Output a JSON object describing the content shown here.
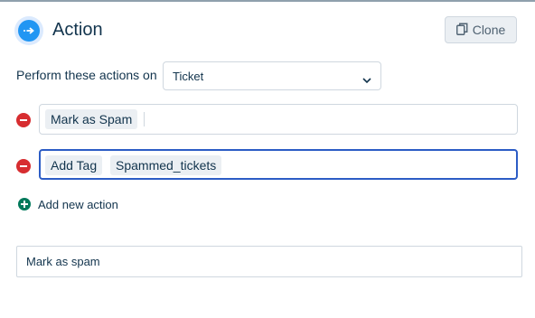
{
  "header": {
    "title": "Action",
    "icon": "arrow-right-circle-icon",
    "clone_label": "Clone",
    "accent": "#2196f3"
  },
  "perform": {
    "label": "Perform these actions on",
    "selected": "Ticket"
  },
  "actions": [
    {
      "chips": [
        "Mark as Spam"
      ]
    },
    {
      "chips": [
        "Add Tag",
        "Spammed_tickets"
      ]
    }
  ],
  "add_action_label": "Add new action",
  "name_field": {
    "value": "Mark as spam"
  },
  "colors": {
    "remove": "#d72d30",
    "add": "#00795b",
    "focus_border": "#2c5cc5"
  }
}
